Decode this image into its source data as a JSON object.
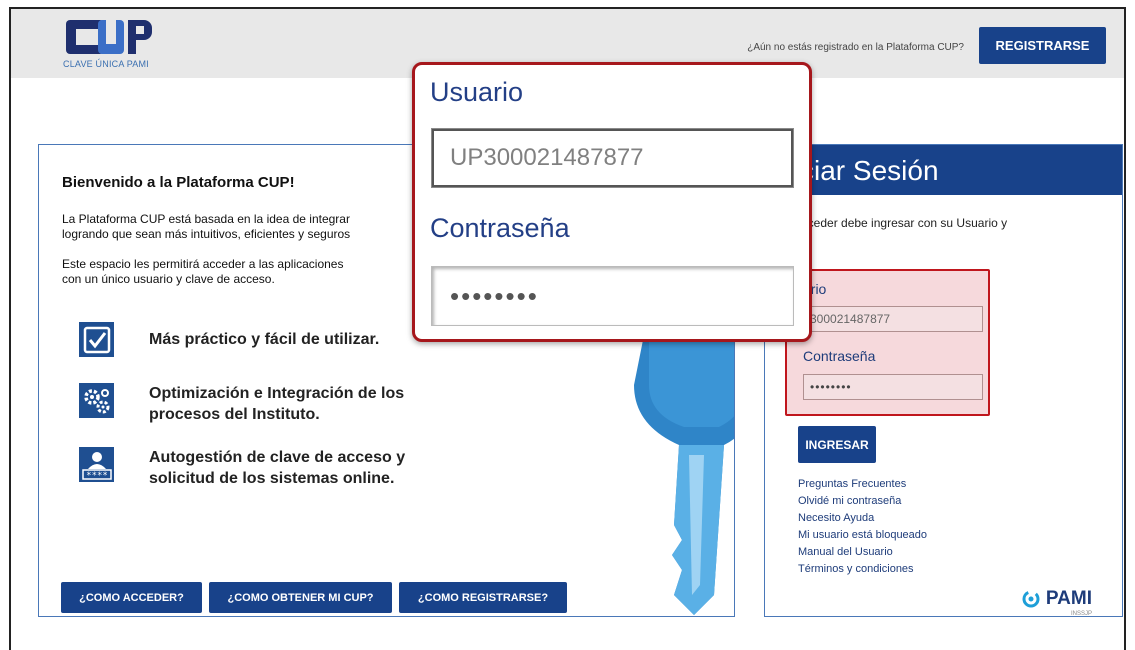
{
  "header": {
    "logo_text": "CUP",
    "logo_subtitle": "CLAVE ÚNICA PAMI",
    "prompt": "¿Aún no estás registrado en la Plataforma CUP?",
    "register_label": "REGISTRARSE"
  },
  "welcome": {
    "title": "Bienvenido a la Plataforma CUP!",
    "para1_line1": "La Plataforma CUP está basada en la idea de integrar",
    "para1_line2": "logrando que sean más intuitivos, eficientes y seguros",
    "para2_line1": "Este espacio les permitirá acceder a las aplicaciones",
    "para2_line2": "con un único usuario y clave de acceso.",
    "features": [
      {
        "icon": "checkbox-icon",
        "text": "Más práctico y fácil de utilizar."
      },
      {
        "icon": "gears-icon",
        "text": "Optimización e Integración de los procesos del Instituto."
      },
      {
        "icon": "user-password-icon",
        "text": "Autogestión de clave de acceso y solicitud de los sistemas online."
      }
    ],
    "buttons": {
      "como_acceder": "¿COMO ACCEDER?",
      "como_obtener": "¿COMO OBTENER MI CUP?",
      "como_registrarse": "¿COMO REGISTRARSE?"
    }
  },
  "login": {
    "title": "ciar Sesión",
    "desc_line1": "acceder debe ingresar con su Usuario y",
    "user_label": "ario",
    "user_value": "300021487877",
    "pass_label": "Contraseña",
    "pass_value": "••••••••",
    "submit_label": "INGRESAR",
    "links": [
      "Preguntas Frecuentes",
      "Olvidé mi contraseña",
      "Necesito Ayuda",
      "Mi usuario está bloqueado",
      "Manual del Usuario",
      "Términos y condiciones"
    ],
    "brand": "PAMI",
    "brand_sub": "INSSJP"
  },
  "zoom": {
    "user_label": "Usuario",
    "user_value": "UP300021487877",
    "pass_label": "Contraseña",
    "pass_value": "••••••••"
  },
  "colors": {
    "brand_blue": "#18428a",
    "highlight_red": "#c0161d",
    "highlight_bg": "#f6d9dc"
  }
}
